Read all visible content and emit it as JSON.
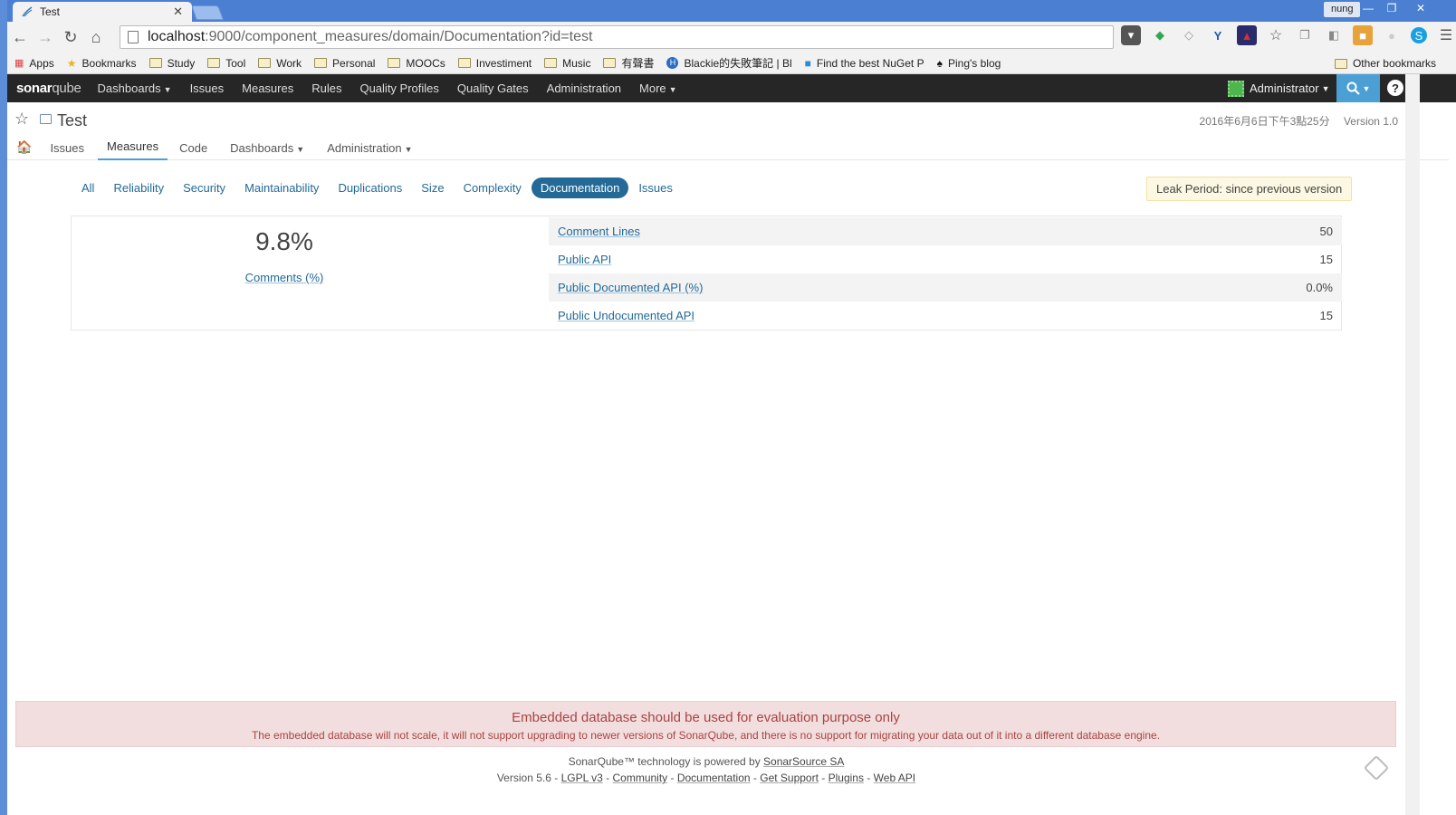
{
  "browser": {
    "tab_title": "Test",
    "tab_close": "✕",
    "user": "nung",
    "url_host": "localhost",
    "url_path": ":9000/component_measures/domain/Documentation?id=test",
    "bookmarks": [
      "Apps",
      "Bookmarks",
      "Study",
      "Tool",
      "Work",
      "Personal",
      "MOOCs",
      "Investiment",
      "Music",
      "有聲書",
      "Blackie的失敗筆記 | Bl",
      "Find the best NuGet P",
      "Ping's blog"
    ],
    "other_bookmarks": "Other bookmarks"
  },
  "sonar_nav": {
    "logo_bold": "sonar",
    "logo_light": "qube",
    "items": [
      "Dashboards",
      "Issues",
      "Measures",
      "Rules",
      "Quality Profiles",
      "Quality Gates",
      "Administration",
      "More"
    ],
    "user": "Administrator"
  },
  "project": {
    "name": "Test",
    "date": "2016年6月6日下午3點25分",
    "version": "Version 1.0",
    "nav": [
      "Issues",
      "Measures",
      "Code",
      "Dashboards",
      "Administration"
    ]
  },
  "measures": {
    "domains": [
      "All",
      "Reliability",
      "Security",
      "Maintainability",
      "Duplications",
      "Size",
      "Complexity",
      "Documentation",
      "Issues"
    ],
    "selected_domain": "Documentation",
    "leak_period": "Leak Period: since previous version",
    "main_value": "9.8%",
    "main_label": "Comments (%)",
    "rows": [
      {
        "label": "Comment Lines",
        "value": "50"
      },
      {
        "label": "Public API",
        "value": "15"
      },
      {
        "label": "Public Documented API (%)",
        "value": "0.0%"
      },
      {
        "label": "Public Undocumented API",
        "value": "15"
      }
    ]
  },
  "footer": {
    "warning_title": "Embedded database should be used for evaluation purpose only",
    "warning_text": "The embedded database will not scale, it will not support upgrading to newer versions of SonarQube, and there is no support for migrating your data out of it into a different database engine.",
    "powered_prefix": "SonarQube™ technology is powered by ",
    "powered_link": "SonarSource SA",
    "version": "Version 5.6",
    "links": [
      "LGPL v3",
      "Community",
      "Documentation",
      "Get Support",
      "Plugins",
      "Web API"
    ]
  },
  "colors": {
    "accent": "#236a97",
    "nav_bg": "#262626",
    "search_bg": "#4b9fd5",
    "warning_bg": "#f2dede"
  }
}
